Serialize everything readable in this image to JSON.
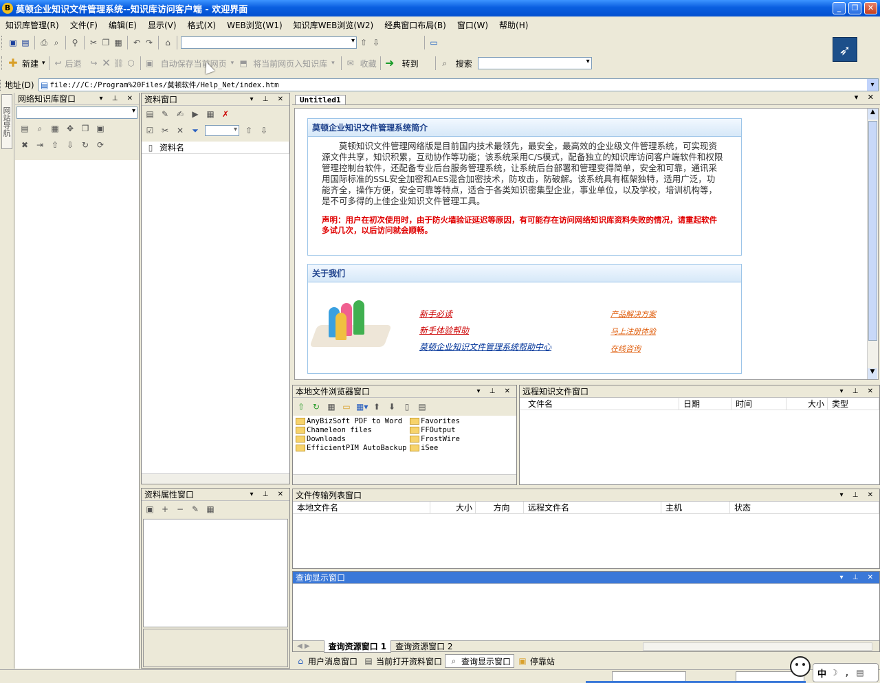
{
  "window": {
    "title": "莫顿企业知识文件管理系统--知识库访问客户端 - 欢迎界面",
    "app_icon_letter": "B"
  },
  "menu": [
    "知识库管理(R)",
    "文件(F)",
    "编辑(E)",
    "显示(V)",
    "格式(X)",
    "WEB浏览(W1)",
    "知识库WEB浏览(W2)",
    "经典窗口布局(B)",
    "窗口(W)",
    "帮助(H)"
  ],
  "toolbar2": {
    "new": "新建",
    "back": "后退",
    "autosave": "自动保存当前网页",
    "import_page": "将当前网页入知识库",
    "favorites": "收藏",
    "goto": "转到",
    "search": "搜索"
  },
  "address": {
    "label": "地址(D)",
    "value": "file:///C:/Program%20Files/莫顿软件/Help_Net/index.htm"
  },
  "side_tab": "网站导航",
  "panels": {
    "network_kb": "网络知识库窗口",
    "resource": "资料窗口",
    "resource_col": "资料名",
    "resource_props": "资料属性窗口",
    "doc_tab": "Untitled1",
    "local_browser": "本地文件浏览器窗口",
    "remote_files": "远程知识文件窗口",
    "transfer": "文件传输列表窗口",
    "query_display": "查询显示窗口"
  },
  "intro": {
    "heading": "莫顿企业知识文件管理系统简介",
    "body": "莫顿知识文件管理网络版是目前国内技术最领先，最安全，最高效的企业级文件管理系统，可实现资源文件共享，知识积累，互动协作等功能；该系统采用C/S模式，配备独立的知识库访问客户端软件和权限管理控制台软件，还配备专业后台服务管理系统，让系统后台部署和管理变得简单，安全和可靠，通讯采用国际标准的SSL安全加密和AES混合加密技术，防攻击，防破解。该系统具有框架独特，适用广泛，功能齐全，操作方便，安全可靠等特点，适合于各类知识密集型企业，事业单位，以及学校，培训机构等，是不可多得的上佳企业知识文件管理工具。",
    "notice": "声明：用户在初次使用时，由于防火墙验证延迟等原因，有可能存在访问网络知识库资料失败的情况，请重起软件多试几次，以后访问就会顺畅。"
  },
  "about": {
    "heading": "关于我们",
    "links_left": [
      "新手必读",
      "新手体验帮助",
      "莫顿企业知识文件管理系统帮助中心"
    ],
    "links_right": [
      "产品解决方案",
      "马上注册体验",
      "在线咨询"
    ]
  },
  "local_files": [
    [
      "AnyBizSoft PDF to Word",
      "Favorites"
    ],
    [
      "Chameleon files",
      "FFOutput"
    ],
    [
      "Downloads",
      "FrostWire"
    ],
    [
      "EfficientPIM AutoBackup",
      "iSee"
    ]
  ],
  "remote_cols": [
    "文件名",
    "日期",
    "时间",
    "大小",
    "类型"
  ],
  "transfer_cols": [
    "本地文件名",
    "大小",
    "方向",
    "远程文件名",
    "主机",
    "状态"
  ],
  "query_tabs": [
    "查询资源窗口 1",
    "查询资源窗口 2"
  ],
  "bottom_tabs": [
    "用户消息窗口",
    "当前打开资料窗口",
    "查询显示窗口",
    "停靠站"
  ],
  "ime": "中"
}
